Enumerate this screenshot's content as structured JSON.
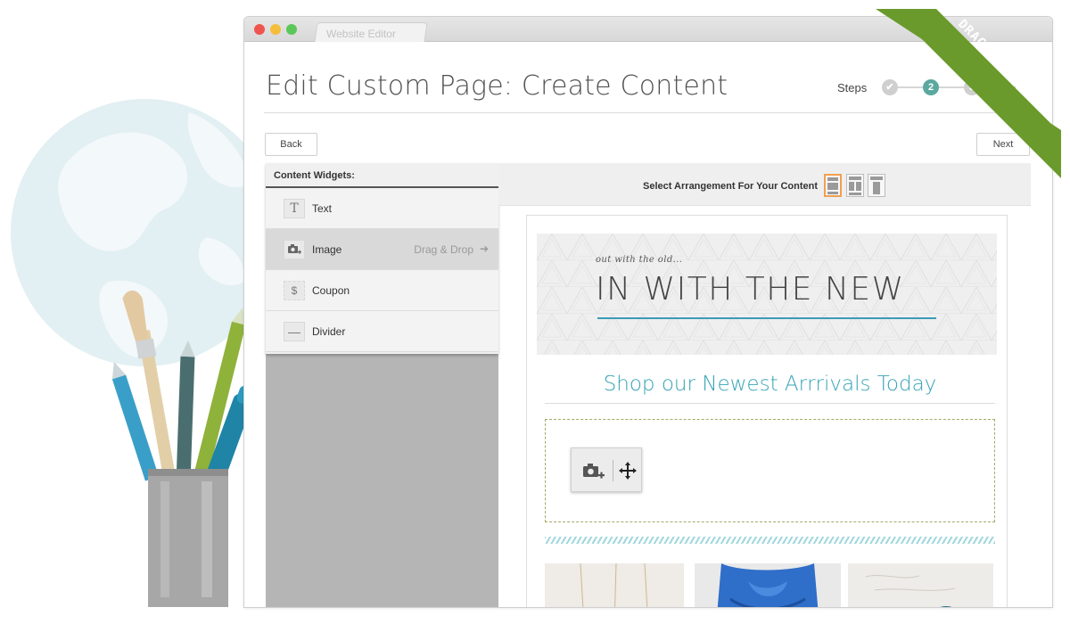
{
  "window": {
    "tab_title": "Website Editor"
  },
  "header": {
    "title": "Edit Custom Page: Create Content",
    "steps_label": "Steps",
    "steps": [
      {
        "label": "✔",
        "state": "complete"
      },
      {
        "label": "2",
        "state": "current"
      },
      {
        "label": "3",
        "state": "upcoming"
      }
    ]
  },
  "nav": {
    "back_label": "Back",
    "next_label": "Next"
  },
  "widgets": {
    "title": "Content Widgets:",
    "items": [
      {
        "label": "Text",
        "icon": "text-icon",
        "glyph": "T"
      },
      {
        "label": "Image",
        "icon": "camera-plus-icon",
        "hint": "Drag & Drop"
      },
      {
        "label": "Coupon",
        "icon": "coupon-dollar-icon",
        "glyph": "$"
      },
      {
        "label": "Divider",
        "icon": "divider-line-icon",
        "glyph": "—"
      }
    ]
  },
  "editor": {
    "arrangement_label": "Select Arrangement For Your Content",
    "layouts": [
      "layout-full-icon",
      "layout-split-icon",
      "layout-columns-icon"
    ],
    "banner": {
      "tagline": "out with the old...",
      "headline": "IN WITH THE NEW"
    },
    "heading": "Shop our Newest Arrrivals Today"
  },
  "ribbon": {
    "text": "DRAG AND DROP"
  },
  "colors": {
    "accent_teal": "#36a3b5",
    "step_active": "#5aa89f",
    "ribbon_green": "#6a9a2c",
    "layout_selected": "#f0a050"
  }
}
